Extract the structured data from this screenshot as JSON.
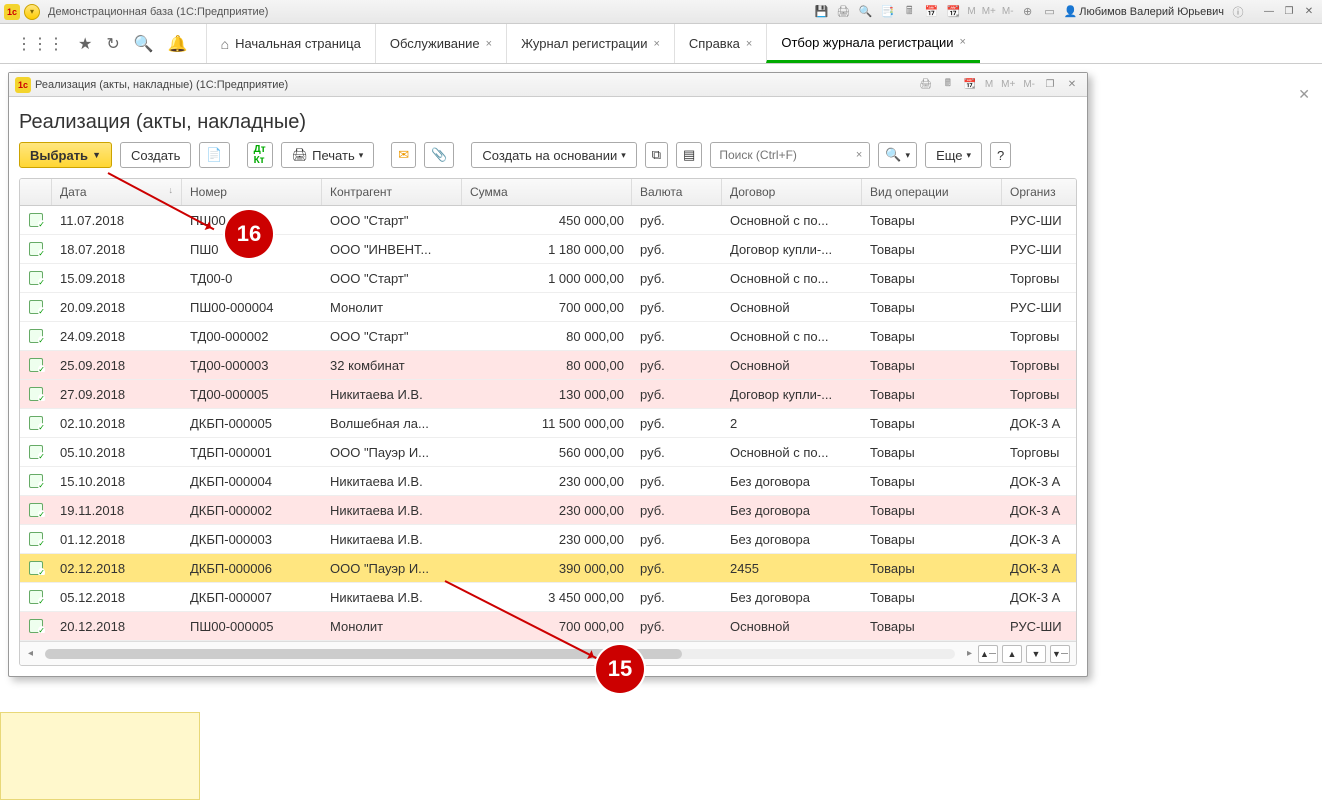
{
  "app": {
    "title": "Демонстрационная база  (1С:Предприятие)",
    "user": "Любимов Валерий Юрьевич",
    "m_labels": [
      "M",
      "M+",
      "M-"
    ]
  },
  "main_tabs": [
    {
      "label": "Начальная страница",
      "home": true
    },
    {
      "label": "Обслуживание"
    },
    {
      "label": "Журнал регистрации"
    },
    {
      "label": "Справка"
    },
    {
      "label": "Отбор журнала регистрации",
      "active": true
    }
  ],
  "sub": {
    "title": "Реализация (акты, накладные)  (1С:Предприятие)",
    "m_labels": [
      "M",
      "M+",
      "M-"
    ],
    "heading": "Реализация (акты, накладные)"
  },
  "toolbar": {
    "select": "Выбрать",
    "create": "Создать",
    "print": "Печать",
    "create_based": "Создать на основании",
    "search_placeholder": "Поиск (Ctrl+F)",
    "more": "Еще",
    "help": "?"
  },
  "columns": {
    "date": "Дата",
    "number": "Номер",
    "agent": "Контрагент",
    "sum": "Сумма",
    "currency": "Валюта",
    "contract": "Договор",
    "optype": "Вид операции",
    "org": "Организ"
  },
  "rows": [
    {
      "date": "11.07.2018",
      "num": "ПШ00",
      "agent": "ООО \"Старт\"",
      "sum": "450 000,00",
      "cur": "руб.",
      "dog": "Основной с по...",
      "op": "Товары",
      "org": "РУС-ШИ"
    },
    {
      "date": "18.07.2018",
      "num": "ПШ0",
      "agent": "ООО \"ИНВЕНТ...",
      "sum": "1 180 000,00",
      "cur": "руб.",
      "dog": "Договор купли-...",
      "op": "Товары",
      "org": "РУС-ШИ"
    },
    {
      "date": "15.09.2018",
      "num": "ТД00-0",
      "agent": "ООО \"Старт\"",
      "sum": "1 000 000,00",
      "cur": "руб.",
      "dog": "Основной с по...",
      "op": "Товары",
      "org": "Торговы"
    },
    {
      "date": "20.09.2018",
      "num": "ПШ00-000004",
      "agent": "Монолит",
      "sum": "700 000,00",
      "cur": "руб.",
      "dog": "Основной",
      "op": "Товары",
      "org": "РУС-ШИ"
    },
    {
      "date": "24.09.2018",
      "num": "ТД00-000002",
      "agent": "ООО \"Старт\"",
      "sum": "80 000,00",
      "cur": "руб.",
      "dog": "Основной с по...",
      "op": "Товары",
      "org": "Торговы"
    },
    {
      "date": "25.09.2018",
      "num": "ТД00-000003",
      "agent": "32 комбинат",
      "sum": "80 000,00",
      "cur": "руб.",
      "dog": "Основной",
      "op": "Товары",
      "org": "Торговы",
      "pink": true
    },
    {
      "date": "27.09.2018",
      "num": "ТД00-000005",
      "agent": "Никитаева И.В.",
      "sum": "130 000,00",
      "cur": "руб.",
      "dog": "Договор купли-...",
      "op": "Товары",
      "org": "Торговы",
      "pink": true
    },
    {
      "date": "02.10.2018",
      "num": "ДКБП-000005",
      "agent": "Волшебная ла...",
      "sum": "11 500 000,00",
      "cur": "руб.",
      "dog": "2",
      "op": "Товары",
      "org": "ДОК-3 А"
    },
    {
      "date": "05.10.2018",
      "num": "ТДБП-000001",
      "agent": "ООО \"Пауэр И...",
      "sum": "560 000,00",
      "cur": "руб.",
      "dog": "Основной с по...",
      "op": "Товары",
      "org": "Торговы"
    },
    {
      "date": "15.10.2018",
      "num": "ДКБП-000004",
      "agent": "Никитаева И.В.",
      "sum": "230 000,00",
      "cur": "руб.",
      "dog": "Без договора",
      "op": "Товары",
      "org": "ДОК-3 А"
    },
    {
      "date": "19.11.2018",
      "num": "ДКБП-000002",
      "agent": "Никитаева И.В.",
      "sum": "230 000,00",
      "cur": "руб.",
      "dog": "Без договора",
      "op": "Товары",
      "org": "ДОК-3 А",
      "pink": true
    },
    {
      "date": "01.12.2018",
      "num": "ДКБП-000003",
      "agent": "Никитаева И.В.",
      "sum": "230 000,00",
      "cur": "руб.",
      "dog": "Без договора",
      "op": "Товары",
      "org": "ДОК-3 А"
    },
    {
      "date": "02.12.2018",
      "num": "ДКБП-000006",
      "agent": "ООО \"Пауэр И...",
      "sum": "390 000,00",
      "cur": "руб.",
      "dog": "2455",
      "op": "Товары",
      "org": "ДОК-3 А",
      "yellow": true
    },
    {
      "date": "05.12.2018",
      "num": "ДКБП-000007",
      "agent": "Никитаева И.В.",
      "sum": "3 450 000,00",
      "cur": "руб.",
      "dog": "Без договора",
      "op": "Товары",
      "org": "ДОК-3 А"
    },
    {
      "date": "20.12.2018",
      "num": "ПШ00-000005",
      "agent": "Монолит",
      "sum": "700 000,00",
      "cur": "руб.",
      "dog": "Основной",
      "op": "Товары",
      "org": "РУС-ШИ",
      "pink": true
    }
  ],
  "markers": {
    "n15": "15",
    "n16": "16"
  }
}
